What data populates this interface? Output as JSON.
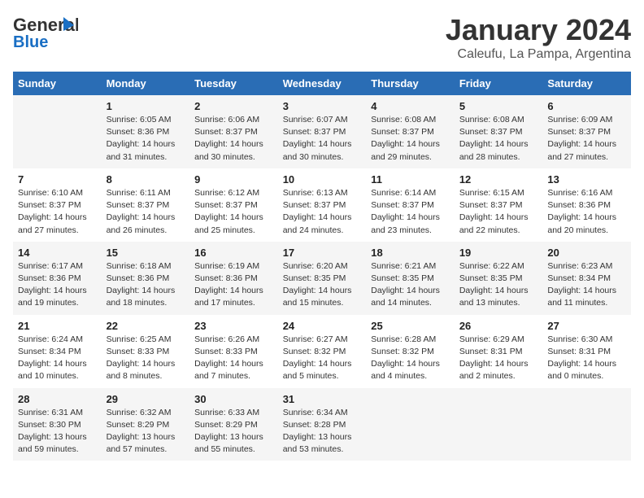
{
  "logo": {
    "text_general": "General",
    "text_blue": "Blue"
  },
  "title": "January 2024",
  "subtitle": "Caleufu, La Pampa, Argentina",
  "days_header": [
    "Sunday",
    "Monday",
    "Tuesday",
    "Wednesday",
    "Thursday",
    "Friday",
    "Saturday"
  ],
  "weeks": [
    [
      {
        "day": "",
        "info": ""
      },
      {
        "day": "1",
        "info": "Sunrise: 6:05 AM\nSunset: 8:36 PM\nDaylight: 14 hours\nand 31 minutes."
      },
      {
        "day": "2",
        "info": "Sunrise: 6:06 AM\nSunset: 8:37 PM\nDaylight: 14 hours\nand 30 minutes."
      },
      {
        "day": "3",
        "info": "Sunrise: 6:07 AM\nSunset: 8:37 PM\nDaylight: 14 hours\nand 30 minutes."
      },
      {
        "day": "4",
        "info": "Sunrise: 6:08 AM\nSunset: 8:37 PM\nDaylight: 14 hours\nand 29 minutes."
      },
      {
        "day": "5",
        "info": "Sunrise: 6:08 AM\nSunset: 8:37 PM\nDaylight: 14 hours\nand 28 minutes."
      },
      {
        "day": "6",
        "info": "Sunrise: 6:09 AM\nSunset: 8:37 PM\nDaylight: 14 hours\nand 27 minutes."
      }
    ],
    [
      {
        "day": "7",
        "info": "Sunrise: 6:10 AM\nSunset: 8:37 PM\nDaylight: 14 hours\nand 27 minutes."
      },
      {
        "day": "8",
        "info": "Sunrise: 6:11 AM\nSunset: 8:37 PM\nDaylight: 14 hours\nand 26 minutes."
      },
      {
        "day": "9",
        "info": "Sunrise: 6:12 AM\nSunset: 8:37 PM\nDaylight: 14 hours\nand 25 minutes."
      },
      {
        "day": "10",
        "info": "Sunrise: 6:13 AM\nSunset: 8:37 PM\nDaylight: 14 hours\nand 24 minutes."
      },
      {
        "day": "11",
        "info": "Sunrise: 6:14 AM\nSunset: 8:37 PM\nDaylight: 14 hours\nand 23 minutes."
      },
      {
        "day": "12",
        "info": "Sunrise: 6:15 AM\nSunset: 8:37 PM\nDaylight: 14 hours\nand 22 minutes."
      },
      {
        "day": "13",
        "info": "Sunrise: 6:16 AM\nSunset: 8:36 PM\nDaylight: 14 hours\nand 20 minutes."
      }
    ],
    [
      {
        "day": "14",
        "info": "Sunrise: 6:17 AM\nSunset: 8:36 PM\nDaylight: 14 hours\nand 19 minutes."
      },
      {
        "day": "15",
        "info": "Sunrise: 6:18 AM\nSunset: 8:36 PM\nDaylight: 14 hours\nand 18 minutes."
      },
      {
        "day": "16",
        "info": "Sunrise: 6:19 AM\nSunset: 8:36 PM\nDaylight: 14 hours\nand 17 minutes."
      },
      {
        "day": "17",
        "info": "Sunrise: 6:20 AM\nSunset: 8:35 PM\nDaylight: 14 hours\nand 15 minutes."
      },
      {
        "day": "18",
        "info": "Sunrise: 6:21 AM\nSunset: 8:35 PM\nDaylight: 14 hours\nand 14 minutes."
      },
      {
        "day": "19",
        "info": "Sunrise: 6:22 AM\nSunset: 8:35 PM\nDaylight: 14 hours\nand 13 minutes."
      },
      {
        "day": "20",
        "info": "Sunrise: 6:23 AM\nSunset: 8:34 PM\nDaylight: 14 hours\nand 11 minutes."
      }
    ],
    [
      {
        "day": "21",
        "info": "Sunrise: 6:24 AM\nSunset: 8:34 PM\nDaylight: 14 hours\nand 10 minutes."
      },
      {
        "day": "22",
        "info": "Sunrise: 6:25 AM\nSunset: 8:33 PM\nDaylight: 14 hours\nand 8 minutes."
      },
      {
        "day": "23",
        "info": "Sunrise: 6:26 AM\nSunset: 8:33 PM\nDaylight: 14 hours\nand 7 minutes."
      },
      {
        "day": "24",
        "info": "Sunrise: 6:27 AM\nSunset: 8:32 PM\nDaylight: 14 hours\nand 5 minutes."
      },
      {
        "day": "25",
        "info": "Sunrise: 6:28 AM\nSunset: 8:32 PM\nDaylight: 14 hours\nand 4 minutes."
      },
      {
        "day": "26",
        "info": "Sunrise: 6:29 AM\nSunset: 8:31 PM\nDaylight: 14 hours\nand 2 minutes."
      },
      {
        "day": "27",
        "info": "Sunrise: 6:30 AM\nSunset: 8:31 PM\nDaylight: 14 hours\nand 0 minutes."
      }
    ],
    [
      {
        "day": "28",
        "info": "Sunrise: 6:31 AM\nSunset: 8:30 PM\nDaylight: 13 hours\nand 59 minutes."
      },
      {
        "day": "29",
        "info": "Sunrise: 6:32 AM\nSunset: 8:29 PM\nDaylight: 13 hours\nand 57 minutes."
      },
      {
        "day": "30",
        "info": "Sunrise: 6:33 AM\nSunset: 8:29 PM\nDaylight: 13 hours\nand 55 minutes."
      },
      {
        "day": "31",
        "info": "Sunrise: 6:34 AM\nSunset: 8:28 PM\nDaylight: 13 hours\nand 53 minutes."
      },
      {
        "day": "",
        "info": ""
      },
      {
        "day": "",
        "info": ""
      },
      {
        "day": "",
        "info": ""
      }
    ]
  ]
}
